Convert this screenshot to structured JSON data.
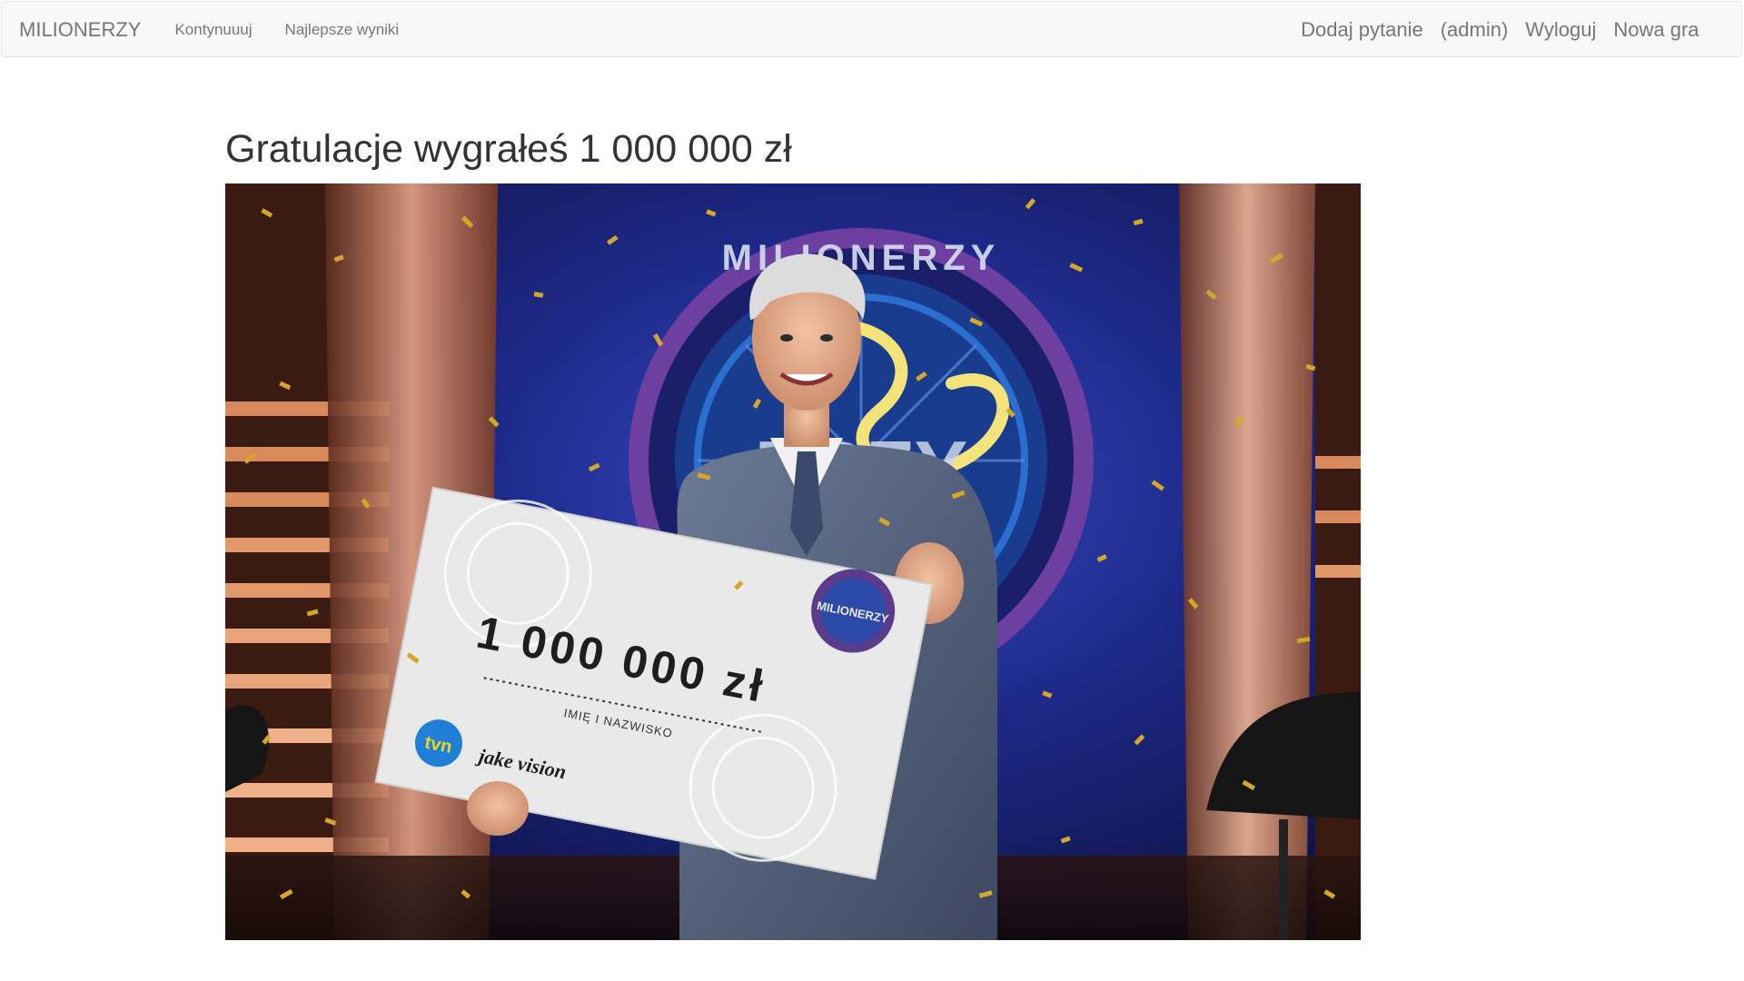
{
  "navbar": {
    "brand": "MILIONERZY",
    "left_links": [
      "Kontynuuuj",
      "Najlepsze wyniki"
    ],
    "right_links": [
      "Dodaj pytanie",
      "(admin)",
      "Wyloguj",
      "Nowa gra"
    ]
  },
  "main": {
    "heading": "Gratulacje wygrałeś 1 000 000 zł",
    "image": {
      "check_amount": "1 000 000 zł",
      "check_signature_label": "IMIĘ I NAZWISKO",
      "logo_text": "MILIONERZY",
      "tvn_logo": "tvn",
      "sponsor_logo": "jake vision"
    }
  },
  "colors": {
    "navbar_bg": "#f8f8f8",
    "navbar_border": "#e7e7e7",
    "nav_text": "#777777",
    "heading_text": "#333333"
  }
}
